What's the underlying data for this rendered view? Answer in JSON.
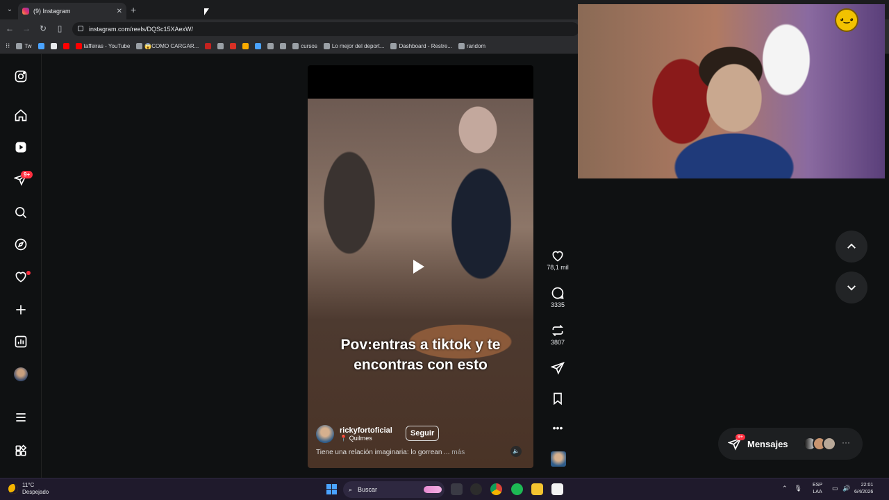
{
  "browser": {
    "tab_title": "(9) Instagram",
    "url": "instagram.com/reels/DQSc15XAexW/",
    "bookmarks": [
      {
        "label": "Tw",
        "color": "#9aa0a6"
      },
      {
        "label": "",
        "color": "#4aa3ff"
      },
      {
        "label": "",
        "color": "#e8eaed"
      },
      {
        "label": "",
        "color": "#ff0000"
      },
      {
        "label": "taffeiras - YouTube",
        "color": "#ff0000"
      },
      {
        "label": "😱COMO CARGAR...",
        "color": "#9aa0a6"
      },
      {
        "label": "",
        "color": "#c5221f"
      },
      {
        "label": "",
        "color": "#9aa0a6"
      },
      {
        "label": "",
        "color": "#d93025"
      },
      {
        "label": "",
        "color": "#f9ab00"
      },
      {
        "label": "",
        "color": "#4aa3ff"
      },
      {
        "label": "",
        "color": "#9aa0a6"
      },
      {
        "label": "",
        "color": "#9aa0a6"
      },
      {
        "label": "cursos",
        "color": "#9aa0a6"
      },
      {
        "label": "Lo mejor del deport...",
        "color": "#9aa0a6"
      },
      {
        "label": "Dashboard - Restre...",
        "color": "#9aa0a6"
      },
      {
        "label": "random",
        "color": "#9aa0a6"
      }
    ]
  },
  "sidebar": {
    "notif_badge": "9+"
  },
  "reel": {
    "caption_line1": "Pov:entras a tiktok y te",
    "caption_line2": "encontras con esto",
    "username": "rickyfortoficial",
    "location": "Quilmes",
    "follow_label": "Seguir",
    "description": "Tiene una relación imaginaria: lo gorrean ...",
    "more_label": "más"
  },
  "actions": {
    "likes": "78,1 mil",
    "comments": "3335",
    "reposts": "3807"
  },
  "messages": {
    "label": "Mensajes",
    "badge": "9+"
  },
  "taskbar": {
    "temperature": "11°C",
    "weather": "Despejado",
    "search_label": "Buscar",
    "lang_top": "ESP",
    "lang_bottom": "LAA",
    "time": "22:01",
    "date": "6/4/2026"
  },
  "colors": {
    "accent_red": "#ff3040",
    "background": "#0f1112"
  }
}
